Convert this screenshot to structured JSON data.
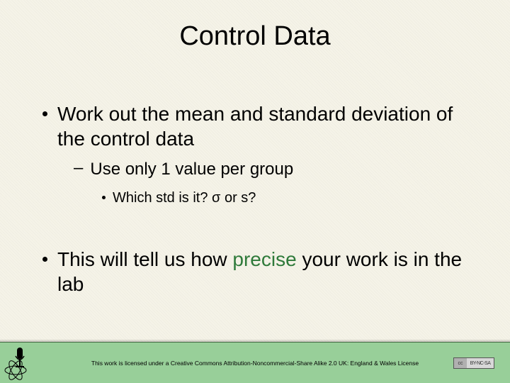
{
  "title": "Control Data",
  "bullets": [
    {
      "text": "Work out the mean and standard deviation of the control data",
      "children": [
        {
          "text": "Use only 1 value per group",
          "children": [
            {
              "text": "Which std is it? σ or s?"
            }
          ]
        }
      ]
    },
    {
      "text_pre": "This will tell us how ",
      "text_em": "precise",
      "text_post": " your work is in the lab"
    }
  ],
  "footer": {
    "license_text": "This work is licensed under a Creative Commons Attribution-Noncommercial-Share Alike 2.0 UK: England & Wales License",
    "cc_left": "cc",
    "cc_right": "BY-NC-SA"
  }
}
